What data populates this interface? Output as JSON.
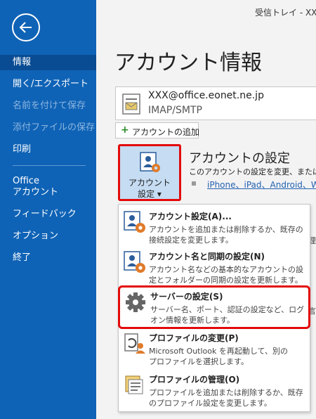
{
  "window": {
    "title": "受信トレイ - XXX"
  },
  "sidebar": {
    "items": [
      {
        "label": "情報"
      },
      {
        "label": "開く/エクスポート"
      },
      {
        "label": "名前を付けて保存"
      },
      {
        "label": "添付ファイルの保存"
      },
      {
        "label": "印刷"
      },
      {
        "label": "Office"
      },
      {
        "label": "アカウント"
      },
      {
        "label": "フィードバック"
      },
      {
        "label": "オプション"
      },
      {
        "label": "終了"
      }
    ]
  },
  "main": {
    "title": "アカウント情報",
    "account": {
      "email": "XXX@office.eonet.ne.jp",
      "type": "IMAP/SMTP"
    },
    "add_account": {
      "label": "アカウントの追加"
    },
    "settings_tile": {
      "line1": "アカウント",
      "line2": "設定 ▾"
    },
    "settings_section": {
      "title": "アカウントの設定",
      "desc": "このアカウントの設定を変更、または追",
      "link": "iPhone、iPad、Android、Win"
    },
    "peek": {
      "p1": "理",
      "p2": "言"
    }
  },
  "dropdown": {
    "items": [
      {
        "title": "アカウント設定(A)...",
        "desc1": "アカウントを追加または削除するか、既存の",
        "desc2": "接続設定を変更します。"
      },
      {
        "title": "アカウント名と同期の設定(N)",
        "desc1": "アカウント名などの基本的なアカウントの設",
        "desc2": "定とフォルダーの同期の設定を更新します。"
      },
      {
        "title": "サーバーの設定(S)",
        "desc1": "サーバー名、ポート、認証の設定など、ログ",
        "desc2": "オン情報を更新します。"
      },
      {
        "title": "プロファイルの変更(P)",
        "desc1": "Microsoft Outlook を再起動して、別の",
        "desc2": "プロファイルを選択します。"
      },
      {
        "title": "プロファイルの管理(O)",
        "desc1": "プロファイルを追加または削除するか、既存",
        "desc2": "のプロファイル設定を変更します。"
      }
    ]
  },
  "colors": {
    "sidebar": "#0f63b6",
    "sidebar_active": "#0a4c93",
    "highlight": "#e30b0b",
    "link": "#2361b0"
  },
  "icons": [
    "back-arrow-icon",
    "account-card-icon",
    "plus-icon",
    "account-gear-icon",
    "gear-icon",
    "profile-change-icon",
    "profile-manage-icon"
  ]
}
